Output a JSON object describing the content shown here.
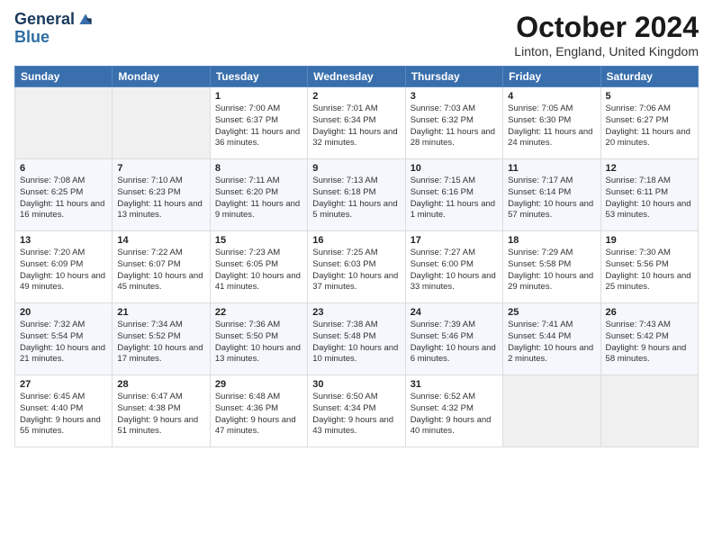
{
  "header": {
    "logo_line1": "General",
    "logo_line2": "Blue",
    "month": "October 2024",
    "location": "Linton, England, United Kingdom"
  },
  "weekdays": [
    "Sunday",
    "Monday",
    "Tuesday",
    "Wednesday",
    "Thursday",
    "Friday",
    "Saturday"
  ],
  "weeks": [
    [
      {
        "day": "",
        "info": ""
      },
      {
        "day": "",
        "info": ""
      },
      {
        "day": "1",
        "info": "Sunrise: 7:00 AM\nSunset: 6:37 PM\nDaylight: 11 hours\nand 36 minutes."
      },
      {
        "day": "2",
        "info": "Sunrise: 7:01 AM\nSunset: 6:34 PM\nDaylight: 11 hours\nand 32 minutes."
      },
      {
        "day": "3",
        "info": "Sunrise: 7:03 AM\nSunset: 6:32 PM\nDaylight: 11 hours\nand 28 minutes."
      },
      {
        "day": "4",
        "info": "Sunrise: 7:05 AM\nSunset: 6:30 PM\nDaylight: 11 hours\nand 24 minutes."
      },
      {
        "day": "5",
        "info": "Sunrise: 7:06 AM\nSunset: 6:27 PM\nDaylight: 11 hours\nand 20 minutes."
      }
    ],
    [
      {
        "day": "6",
        "info": "Sunrise: 7:08 AM\nSunset: 6:25 PM\nDaylight: 11 hours\nand 16 minutes."
      },
      {
        "day": "7",
        "info": "Sunrise: 7:10 AM\nSunset: 6:23 PM\nDaylight: 11 hours\nand 13 minutes."
      },
      {
        "day": "8",
        "info": "Sunrise: 7:11 AM\nSunset: 6:20 PM\nDaylight: 11 hours\nand 9 minutes."
      },
      {
        "day": "9",
        "info": "Sunrise: 7:13 AM\nSunset: 6:18 PM\nDaylight: 11 hours\nand 5 minutes."
      },
      {
        "day": "10",
        "info": "Sunrise: 7:15 AM\nSunset: 6:16 PM\nDaylight: 11 hours\nand 1 minute."
      },
      {
        "day": "11",
        "info": "Sunrise: 7:17 AM\nSunset: 6:14 PM\nDaylight: 10 hours\nand 57 minutes."
      },
      {
        "day": "12",
        "info": "Sunrise: 7:18 AM\nSunset: 6:11 PM\nDaylight: 10 hours\nand 53 minutes."
      }
    ],
    [
      {
        "day": "13",
        "info": "Sunrise: 7:20 AM\nSunset: 6:09 PM\nDaylight: 10 hours\nand 49 minutes."
      },
      {
        "day": "14",
        "info": "Sunrise: 7:22 AM\nSunset: 6:07 PM\nDaylight: 10 hours\nand 45 minutes."
      },
      {
        "day": "15",
        "info": "Sunrise: 7:23 AM\nSunset: 6:05 PM\nDaylight: 10 hours\nand 41 minutes."
      },
      {
        "day": "16",
        "info": "Sunrise: 7:25 AM\nSunset: 6:03 PM\nDaylight: 10 hours\nand 37 minutes."
      },
      {
        "day": "17",
        "info": "Sunrise: 7:27 AM\nSunset: 6:00 PM\nDaylight: 10 hours\nand 33 minutes."
      },
      {
        "day": "18",
        "info": "Sunrise: 7:29 AM\nSunset: 5:58 PM\nDaylight: 10 hours\nand 29 minutes."
      },
      {
        "day": "19",
        "info": "Sunrise: 7:30 AM\nSunset: 5:56 PM\nDaylight: 10 hours\nand 25 minutes."
      }
    ],
    [
      {
        "day": "20",
        "info": "Sunrise: 7:32 AM\nSunset: 5:54 PM\nDaylight: 10 hours\nand 21 minutes."
      },
      {
        "day": "21",
        "info": "Sunrise: 7:34 AM\nSunset: 5:52 PM\nDaylight: 10 hours\nand 17 minutes."
      },
      {
        "day": "22",
        "info": "Sunrise: 7:36 AM\nSunset: 5:50 PM\nDaylight: 10 hours\nand 13 minutes."
      },
      {
        "day": "23",
        "info": "Sunrise: 7:38 AM\nSunset: 5:48 PM\nDaylight: 10 hours\nand 10 minutes."
      },
      {
        "day": "24",
        "info": "Sunrise: 7:39 AM\nSunset: 5:46 PM\nDaylight: 10 hours\nand 6 minutes."
      },
      {
        "day": "25",
        "info": "Sunrise: 7:41 AM\nSunset: 5:44 PM\nDaylight: 10 hours\nand 2 minutes."
      },
      {
        "day": "26",
        "info": "Sunrise: 7:43 AM\nSunset: 5:42 PM\nDaylight: 9 hours\nand 58 minutes."
      }
    ],
    [
      {
        "day": "27",
        "info": "Sunrise: 6:45 AM\nSunset: 4:40 PM\nDaylight: 9 hours\nand 55 minutes."
      },
      {
        "day": "28",
        "info": "Sunrise: 6:47 AM\nSunset: 4:38 PM\nDaylight: 9 hours\nand 51 minutes."
      },
      {
        "day": "29",
        "info": "Sunrise: 6:48 AM\nSunset: 4:36 PM\nDaylight: 9 hours\nand 47 minutes."
      },
      {
        "day": "30",
        "info": "Sunrise: 6:50 AM\nSunset: 4:34 PM\nDaylight: 9 hours\nand 43 minutes."
      },
      {
        "day": "31",
        "info": "Sunrise: 6:52 AM\nSunset: 4:32 PM\nDaylight: 9 hours\nand 40 minutes."
      },
      {
        "day": "",
        "info": ""
      },
      {
        "day": "",
        "info": ""
      }
    ]
  ]
}
